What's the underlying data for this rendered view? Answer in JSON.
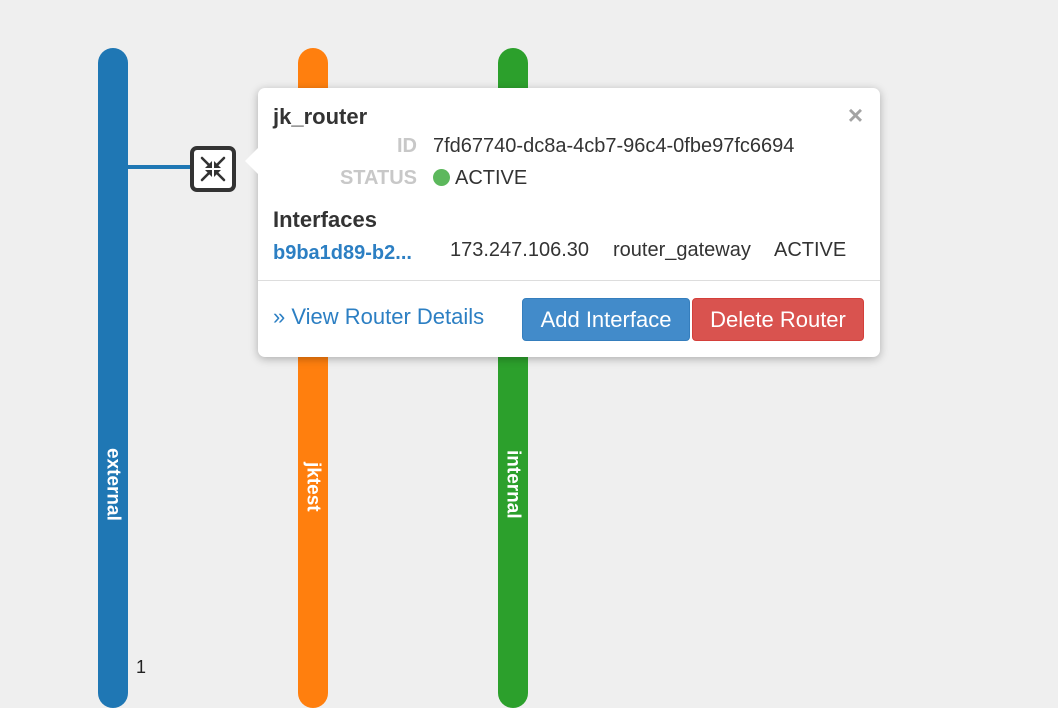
{
  "networks": [
    {
      "name": "external",
      "color": "#1f77b4"
    },
    {
      "name": "jktest",
      "color": "#ff7f0e"
    },
    {
      "name": "internal",
      "color": "#2ca02c"
    }
  ],
  "stray_text": "1",
  "router": {
    "name": "jk_router",
    "id_label": "ID",
    "id": "7fd67740-dc8a-4cb7-96c4-0fbe97fc6694",
    "status_label": "STATUS",
    "status": "ACTIVE",
    "status_color": "#5cb85c",
    "link_color": "#1f77b4"
  },
  "popover": {
    "close_symbol": "×",
    "interfaces_heading": "Interfaces",
    "interfaces": [
      {
        "id": "b9ba1d89-b2...",
        "ip": "173.247.106.30",
        "type": "router_gateway",
        "status": "ACTIVE"
      }
    ],
    "view_details_label": "» View Router Details",
    "add_interface_label": "Add Interface",
    "delete_router_label": "Delete Router"
  },
  "colors": {
    "background": "#efefef",
    "link": "#2c7fc3",
    "primary_button": "#428bca",
    "danger_button": "#d9534f"
  },
  "icons": {
    "router": "router-arrows-icon",
    "close": "close-icon",
    "status": "status-dot-icon"
  }
}
